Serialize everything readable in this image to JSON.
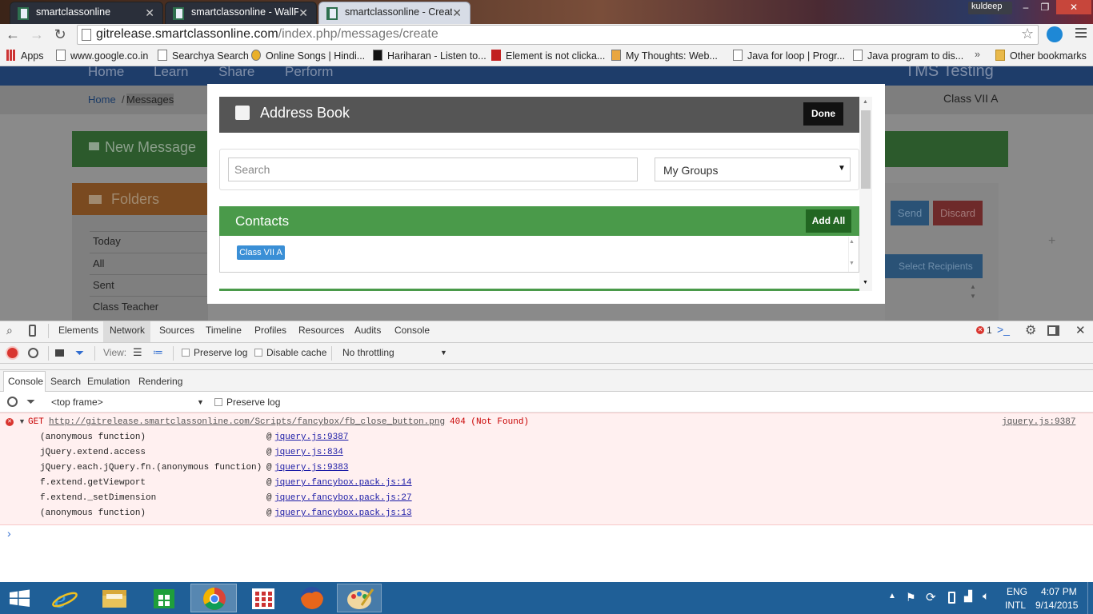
{
  "browser": {
    "tabs": [
      {
        "title": "smartclassonline",
        "active": false
      },
      {
        "title": "smartclassonline - WallPo",
        "active": false
      },
      {
        "title": "smartclassonline - Create",
        "active": true
      }
    ],
    "profile_name": "kuldeep",
    "url_host": "gitrelease.smartclassonline.com",
    "url_path": "/index.php/messages/create",
    "bookmarks": [
      "Apps",
      "www.google.co.in",
      "Searchya Search",
      "Online Songs | Hindi...",
      "Hariharan - Listen to...",
      "Element is not clicka...",
      "My Thoughts: Web...",
      "Java for loop | Progr...",
      "Java program to dis..."
    ],
    "bookmarks_more": "»",
    "other_bookmarks": "Other bookmarks"
  },
  "page": {
    "nav": [
      "Home",
      "Learn",
      "Share",
      "Perform"
    ],
    "site_title": "TMS Testing",
    "breadcrumb_home": "Home",
    "breadcrumb_sep": "/",
    "breadcrumb_current": "Messages",
    "class_label": "Class VII A",
    "new_message": "New Message",
    "folders_title": "Folders",
    "folders": [
      "Today",
      "All",
      "Sent",
      "Class Teacher"
    ],
    "send_label": "Send",
    "discard_label": "Discard",
    "select_recipients": "Select Recipients"
  },
  "modal": {
    "title": "Address Book",
    "done_label": "Done",
    "search_placeholder": "Search",
    "group_selected": "My Groups",
    "contacts_title": "Contacts",
    "add_all_label": "Add All",
    "contacts": [
      "Class VII A"
    ]
  },
  "devtools": {
    "tabs": [
      "Elements",
      "Network",
      "Sources",
      "Timeline",
      "Profiles",
      "Resources",
      "Audits",
      "Console"
    ],
    "active_tab": "Network",
    "error_count": "1",
    "view_label": "View:",
    "preserve_log_label": "Preserve log",
    "disable_cache_label": "Disable cache",
    "throttling_label": "No throttling",
    "drawer_tabs": [
      "Console",
      "Search",
      "Emulation",
      "Rendering"
    ],
    "frame_label": "<top frame>",
    "console_preserve_log": "Preserve log",
    "error": {
      "method": "GET",
      "url": "http://gitrelease.smartclassonline.com/Scripts/fancybox/fb_close_button.png",
      "status": "404 (Not Found)",
      "source": "jquery.js:9387"
    },
    "stack": [
      {
        "fn": "(anonymous function)",
        "loc": "jquery.js:9387"
      },
      {
        "fn": "jQuery.extend.access",
        "loc": "jquery.js:834"
      },
      {
        "fn": "jQuery.each.jQuery.fn.(anonymous function)",
        "loc": "jquery.js:9383"
      },
      {
        "fn": "f.extend.getViewport",
        "loc": "jquery.fancybox.pack.js:14"
      },
      {
        "fn": "f.extend._setDimension",
        "loc": "jquery.fancybox.pack.js:27"
      },
      {
        "fn": "(anonymous function)",
        "loc": "jquery.fancybox.pack.js:13"
      }
    ],
    "prompt": "›"
  },
  "taskbar": {
    "lang_top": "ENG",
    "lang_bottom": "INTL",
    "time": "4:07 PM",
    "date": "9/14/2015"
  },
  "colors": {
    "modal_header": "#555555",
    "contacts_green": "#4a9a4a",
    "add_all_green": "#226622",
    "tag_blue": "#3a8fd6",
    "error_red": "#c80000",
    "taskbar_blue": "#1f5f97"
  }
}
